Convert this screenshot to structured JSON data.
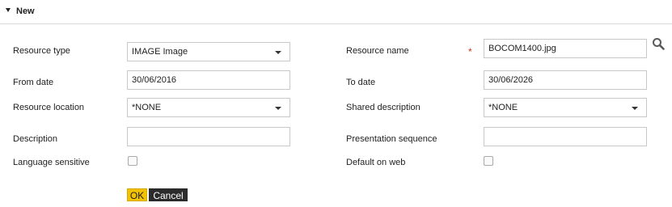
{
  "section": {
    "title": "New"
  },
  "form": {
    "resource_type": {
      "label": "Resource type",
      "value": "IMAGE Image"
    },
    "resource_name": {
      "label": "Resource name",
      "required_mark": "*",
      "value": "BOCOM1400.jpg"
    },
    "from_date": {
      "label": "From date",
      "value": "30/06/2016"
    },
    "to_date": {
      "label": "To date",
      "value": "30/06/2026"
    },
    "resource_location": {
      "label": "Resource location",
      "value": "*NONE"
    },
    "shared_description": {
      "label": "Shared description",
      "value": "*NONE"
    },
    "description": {
      "label": "Description",
      "value": ""
    },
    "presentation_sequence": {
      "label": "Presentation sequence",
      "value": ""
    },
    "language_sensitive": {
      "label": "Language sensitive",
      "checked": false
    },
    "default_on_web": {
      "label": "Default on web",
      "checked": false
    }
  },
  "buttons": {
    "ok": "OK",
    "cancel": "Cancel"
  },
  "icons": {
    "section_toggle": "caret-down-icon",
    "search": "search-icon"
  },
  "colors": {
    "ok_button": "#f2c200",
    "cancel_button": "#2b2b2b",
    "required": "#c8351a"
  }
}
